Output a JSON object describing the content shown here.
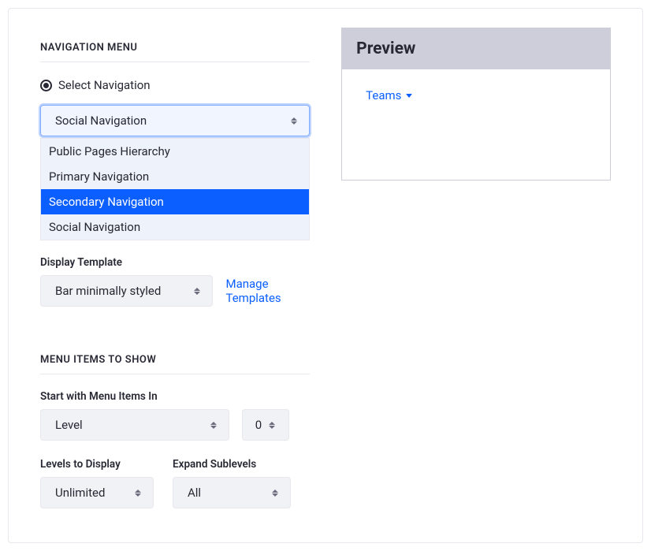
{
  "sections": {
    "navigation_menu_title": "NAVIGATION MENU",
    "menu_items_title": "MENU ITEMS TO SHOW"
  },
  "select_navigation": {
    "radio_label": "Select Navigation",
    "current_value": "Social Navigation",
    "options": [
      "Public Pages Hierarchy",
      "Primary Navigation",
      "Secondary Navigation",
      "Social Navigation"
    ],
    "highlighted_index": 2
  },
  "display_template": {
    "label": "Display Template",
    "value": "Bar minimally styled",
    "manage_link": "Manage Templates"
  },
  "start_items": {
    "label": "Start with Menu Items In",
    "select_value": "Level",
    "number_value": "0"
  },
  "levels_to_display": {
    "label": "Levels to Display",
    "value": "Unlimited"
  },
  "expand_sublevels": {
    "label": "Expand Sublevels",
    "value": "All"
  },
  "preview": {
    "title": "Preview",
    "link_text": "Teams"
  }
}
